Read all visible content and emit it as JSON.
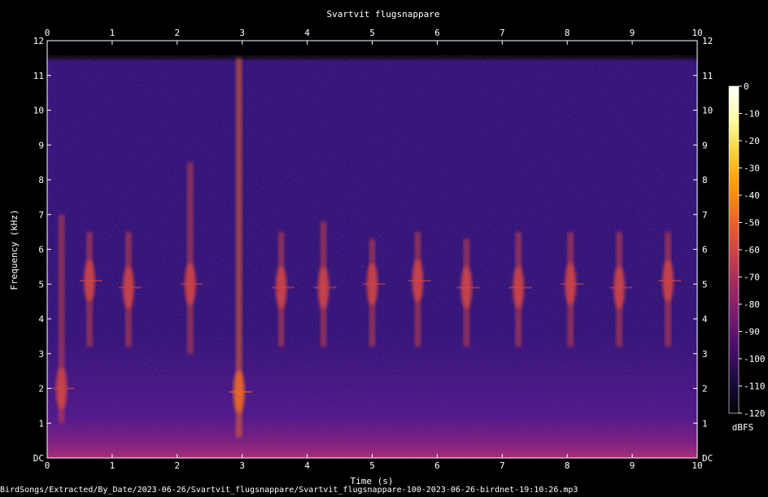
{
  "chart_data": {
    "type": "heatmap",
    "title": "Svartvit flugsnappare",
    "xlabel": "Time (s)",
    "ylabel": "Frequency (kHz)",
    "xlim": [
      0,
      10
    ],
    "ylim": [
      0,
      12
    ],
    "x_ticks": [
      "0",
      "1",
      "2",
      "3",
      "4",
      "5",
      "6",
      "7",
      "8",
      "9",
      "10"
    ],
    "y_ticks": [
      "DC",
      "1",
      "2",
      "3",
      "4",
      "5",
      "6",
      "7",
      "8",
      "9",
      "10",
      "11",
      "12"
    ],
    "colorbar": {
      "label": "dBFS",
      "range": [
        -120,
        0
      ],
      "ticks": [
        "0",
        "-10",
        "-20",
        "-30",
        "-40",
        "-50",
        "-60",
        "-70",
        "-80",
        "-90",
        "-100",
        "-110",
        "-120"
      ],
      "colors": [
        "#000004",
        "#1b0c41",
        "#4a0c6b",
        "#781c6d",
        "#a52c60",
        "#cf4446",
        "#ed6925",
        "#fb9b06",
        "#f7d13d",
        "#fcffa4",
        "#ffffff"
      ]
    },
    "background_level_dbfs": -100,
    "calls": [
      {
        "t": 0.22,
        "fmin": 1.0,
        "fmax": 7.0,
        "peak_khz": 2.0,
        "level_dbfs": -62
      },
      {
        "t": 0.65,
        "fmin": 3.2,
        "fmax": 6.5,
        "peak_khz": 5.1,
        "level_dbfs": -58
      },
      {
        "t": 1.25,
        "fmin": 3.2,
        "fmax": 6.5,
        "peak_khz": 4.9,
        "level_dbfs": -62
      },
      {
        "t": 2.2,
        "fmin": 3.0,
        "fmax": 8.5,
        "peak_khz": 5.0,
        "level_dbfs": -55
      },
      {
        "t": 2.95,
        "fmin": 0.6,
        "fmax": 11.5,
        "peak_khz": 1.9,
        "level_dbfs": -52
      },
      {
        "t": 3.6,
        "fmin": 3.2,
        "fmax": 6.5,
        "peak_khz": 4.9,
        "level_dbfs": -60
      },
      {
        "t": 4.25,
        "fmin": 3.2,
        "fmax": 6.8,
        "peak_khz": 4.9,
        "level_dbfs": -58
      },
      {
        "t": 5.0,
        "fmin": 3.2,
        "fmax": 6.3,
        "peak_khz": 5.0,
        "level_dbfs": -60
      },
      {
        "t": 5.7,
        "fmin": 3.2,
        "fmax": 6.5,
        "peak_khz": 5.1,
        "level_dbfs": -60
      },
      {
        "t": 6.45,
        "fmin": 3.2,
        "fmax": 6.3,
        "peak_khz": 4.9,
        "level_dbfs": -60
      },
      {
        "t": 7.25,
        "fmin": 3.2,
        "fmax": 6.5,
        "peak_khz": 4.9,
        "level_dbfs": -58
      },
      {
        "t": 8.05,
        "fmin": 3.2,
        "fmax": 6.5,
        "peak_khz": 5.0,
        "level_dbfs": -58
      },
      {
        "t": 8.8,
        "fmin": 3.2,
        "fmax": 6.5,
        "peak_khz": 4.9,
        "level_dbfs": -58
      },
      {
        "t": 9.55,
        "fmin": 3.2,
        "fmax": 6.5,
        "peak_khz": 5.1,
        "level_dbfs": -58
      }
    ]
  },
  "footer_path": "BirdSongs/Extracted/By_Date/2023-06-26/Svartvit_flugsnappare/Svartvit_flugsnappare-100-2023-06-26-birdnet-19:10:26.mp3"
}
